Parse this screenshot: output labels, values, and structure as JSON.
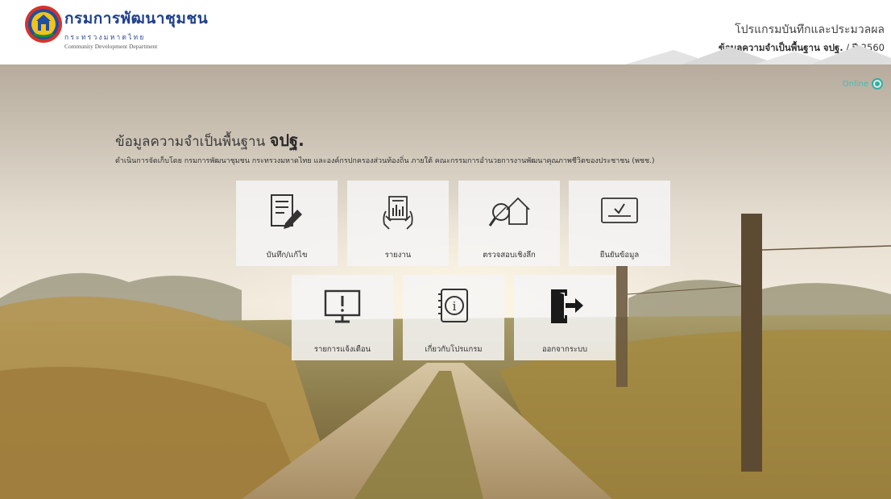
{
  "header": {
    "brand_name": "กรมการพัฒนาชุมชน",
    "ministry": "กระทรวงมหาดไทย",
    "brand_en": "Community Development Department",
    "program_title": "โปรแกรมบันทึกและประมวลผล",
    "program_sub_bold": "ข้อมูลความจำเป็นพื้นฐาน จปฐ.",
    "program_sub_year": " / ปี 2560"
  },
  "status": {
    "label": "Online",
    "color": "#2ab3a6"
  },
  "intro": {
    "headline": "ข้อมูลความจำเป็นพื้นฐาน",
    "headline_bold": "จปฐ.",
    "description": "ดำเนินการจัดเก็บโดย กรมการพัฒนาชุมชน กระทรวงมหาดไทย และองค์กรปกครองส่วนท้องถิ่น ภายใต้ คณะกรรมการอำนวยการงานพัฒนาคุณภาพชีวิตของประชาชน (พชช.)"
  },
  "menu": [
    {
      "label": "บันทึก/แก้ไข",
      "icon": "edit-document-icon"
    },
    {
      "label": "รายงาน",
      "icon": "report-icon"
    },
    {
      "label": "ตรวจสอบเชิงลึก",
      "icon": "inspect-house-icon"
    },
    {
      "label": "ยืนยันข้อมูล",
      "icon": "confirm-data-icon"
    },
    {
      "label": "รายการแจ้งเตือน",
      "icon": "alert-monitor-icon"
    },
    {
      "label": "เกี่ยวกับโปรแกรม",
      "icon": "info-icon"
    },
    {
      "label": "ออกจากระบบ",
      "icon": "logout-icon"
    }
  ],
  "colors": {
    "brand_blue": "#1f3f8f",
    "online_teal": "#2ab3a6"
  }
}
